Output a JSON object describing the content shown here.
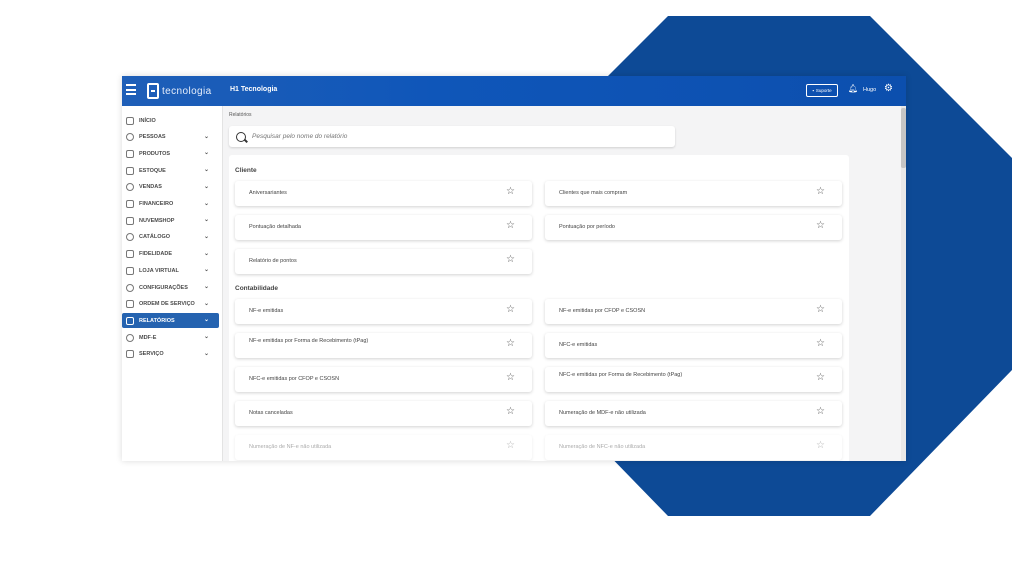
{
  "brand": {
    "logo_text": "tecnologia",
    "accent": "#0c4fae",
    "background_shape": "#0d4a96"
  },
  "topbar": {
    "company": "H1 Tecnologia",
    "support_label": "Suporte",
    "user_name": "Hugo",
    "icons": [
      "menu-icon",
      "bell-icon",
      "gear-icon",
      "chat-icon"
    ]
  },
  "sidebar": {
    "items": [
      {
        "label": "INÍCIO",
        "icon": "home-icon",
        "expandable": false
      },
      {
        "label": "PESSOAS",
        "icon": "person-icon",
        "expandable": true
      },
      {
        "label": "PRODUTOS",
        "icon": "box-icon",
        "expandable": true
      },
      {
        "label": "ESTOQUE",
        "icon": "stock-icon",
        "expandable": true
      },
      {
        "label": "VENDAS",
        "icon": "cart-icon",
        "expandable": true
      },
      {
        "label": "FINANCEIRO",
        "icon": "money-icon",
        "expandable": true
      },
      {
        "label": "NUVEMSHOP",
        "icon": "shop-icon",
        "expandable": true
      },
      {
        "label": "CATÁLOGO",
        "icon": "catalog-icon",
        "expandable": true
      },
      {
        "label": "FIDELIDADE",
        "icon": "loyalty-icon",
        "expandable": true
      },
      {
        "label": "LOJA VIRTUAL",
        "icon": "store-icon",
        "expandable": true
      },
      {
        "label": "CONFIGURAÇÕES",
        "icon": "settings-icon",
        "expandable": true
      },
      {
        "label": "ORDEM DE SERVIÇO",
        "icon": "service-order-icon",
        "expandable": true
      },
      {
        "label": "RELATÓRIOS",
        "icon": "report-icon",
        "expandable": true,
        "active": true
      },
      {
        "label": "MDF-E",
        "icon": "truck-icon",
        "expandable": true
      },
      {
        "label": "SERVIÇO",
        "icon": "service-icon",
        "expandable": true
      }
    ]
  },
  "main": {
    "breadcrumb": "Relatórios",
    "search_placeholder": "Pesquisar pelo nome do relatório",
    "sections": [
      {
        "title": "Cliente",
        "reports": [
          "Aniversariantes",
          "Clientes que mais compram",
          "Pontuação detalhada",
          "Pontuação por período",
          "Relatório de pontos"
        ]
      },
      {
        "title": "Contabilidade",
        "reports": [
          "NF-e emitidas",
          "NF-e emitidas por CFOP e CSOSN",
          "NF-e emitidas por Forma de Recebimento (tPag)",
          "NFC-e emitidas",
          "NFC-e emitidas por CFOP e CSOSN",
          "NFC-e emitidas por Forma de Recebimento (tPag)",
          "Notas canceladas",
          "Numeração de MDF-e não utilizada",
          "Numeração de NF-e não utilizada",
          "Numeração de NFC-e não utilizada"
        ]
      }
    ]
  }
}
